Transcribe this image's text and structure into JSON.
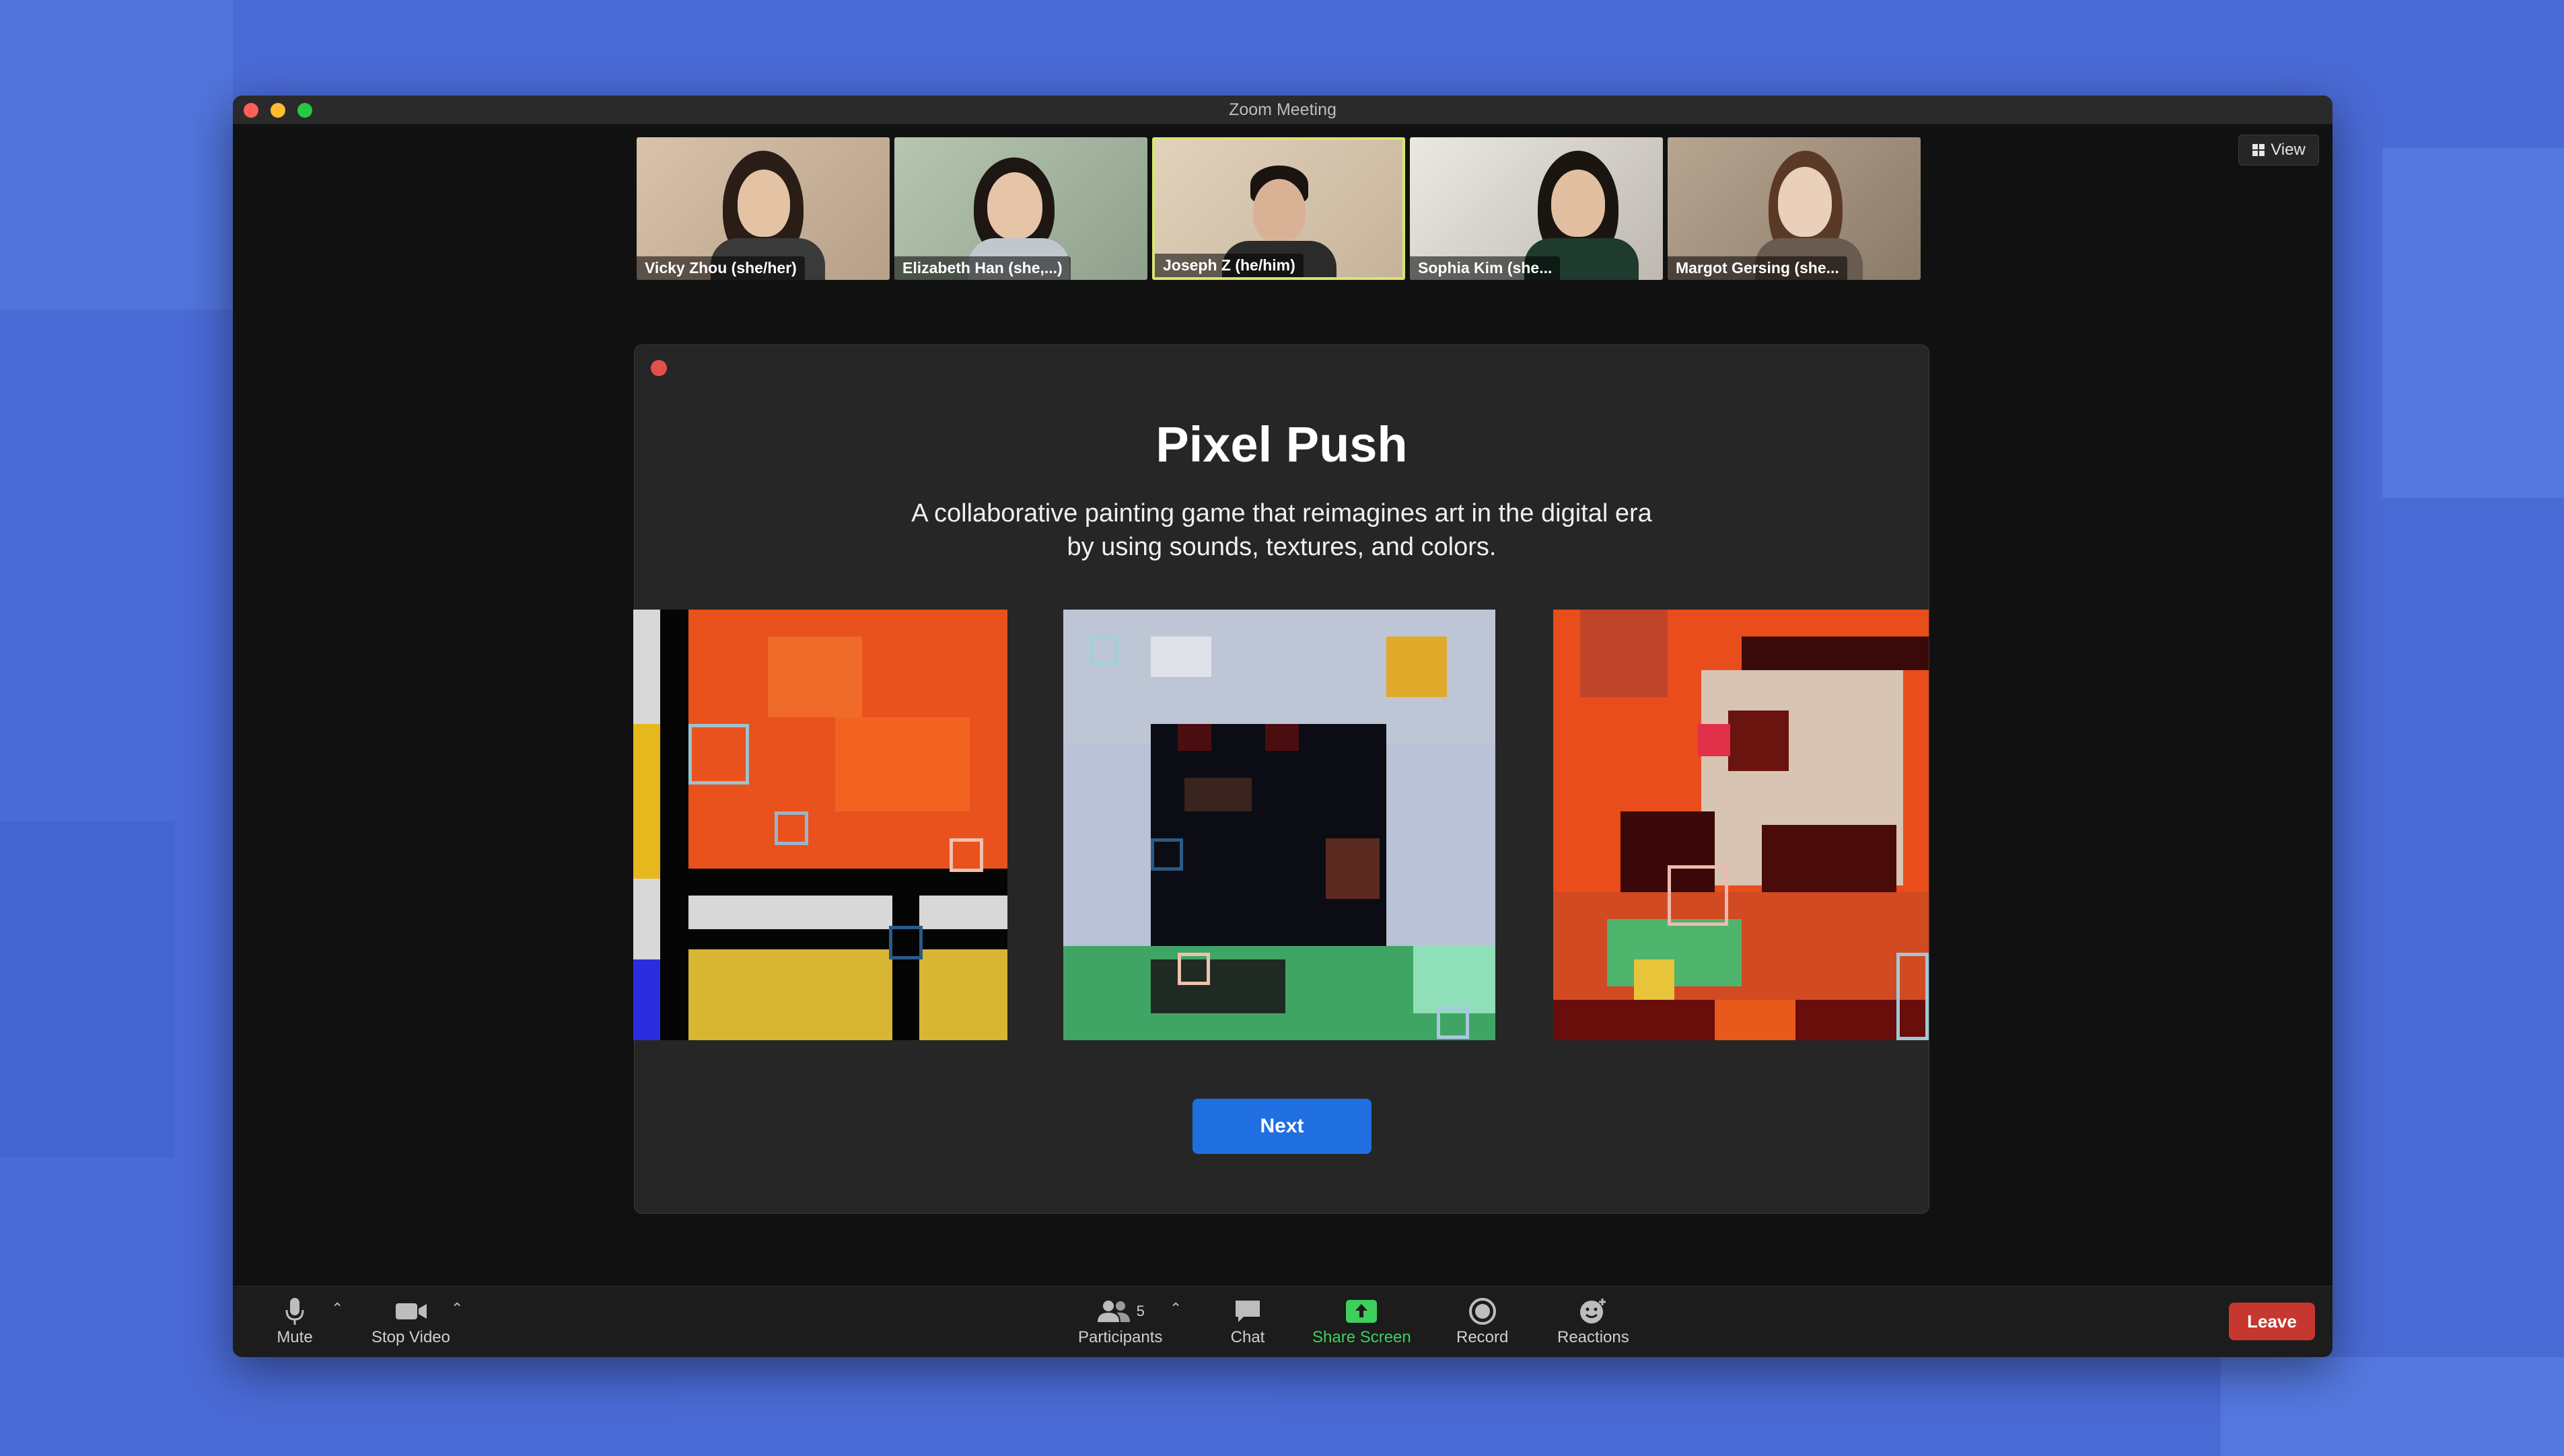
{
  "window": {
    "title": "Zoom Meeting"
  },
  "header": {
    "view_label": "View"
  },
  "participants": [
    {
      "name": "Vicky Zhou (she/her)",
      "bg": "#c9b49e",
      "face": "#e4c3a5",
      "hair": "#2a1d16"
    },
    {
      "name": "Elizabeth Han (she,...)",
      "bg": "#a9b9a3",
      "face": "#e6c4a8",
      "hair": "#1d1612"
    },
    {
      "name": "Joseph Z (he/him)",
      "bg": "#d9c8b0",
      "face": "#d9b295",
      "hair": "#1a1410"
    },
    {
      "name": "Sophia Kim (she...",
      "bg": "#e3e0da",
      "face": "#e2bfa0",
      "hair": "#1b1512"
    },
    {
      "name": "Margot Gersing (she...",
      "bg": "#a99784",
      "face": "#ead0ba",
      "hair": "#5a3a26"
    }
  ],
  "game": {
    "title": "Pixel Push",
    "subtitle_line1": "A collaborative painting game that reimagines art in the digital era",
    "subtitle_line2": "by using sounds, textures, and colors.",
    "next_label": "Next"
  },
  "toolbar": {
    "mute": "Mute",
    "stop_video": "Stop Video",
    "participants": "Participants",
    "participants_count": "5",
    "chat": "Chat",
    "share_screen": "Share Screen",
    "record": "Record",
    "reactions": "Reactions",
    "leave": "Leave"
  },
  "colors": {
    "accent_blue": "#1f6fe0",
    "share_green": "#3fcf5f",
    "leave_red": "#c6372f",
    "background_blue": "#4a6ad6"
  }
}
